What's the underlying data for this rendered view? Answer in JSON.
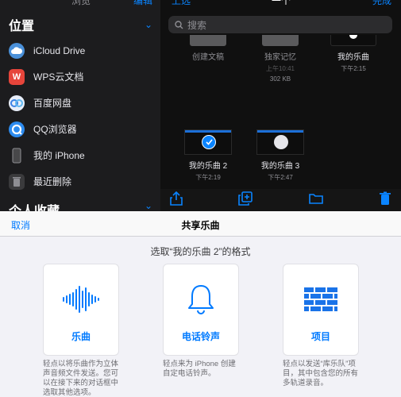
{
  "sidebar": {
    "top_fragment_left": "浏览",
    "top_fragment_right": "编辑",
    "locations_title": "位置",
    "locations": [
      {
        "label": "iCloud Drive",
        "icon": "icloud-icon",
        "color": "#4a90d9"
      },
      {
        "label": "WPS云文档",
        "icon": "wps-icon",
        "color": "#e6453b"
      },
      {
        "label": "百度网盘",
        "icon": "baidu-netdisk-icon",
        "color": "#3b82e6"
      },
      {
        "label": "QQ浏览器",
        "icon": "qq-browser-icon",
        "color": "#2d8cf0"
      },
      {
        "label": "我的 iPhone",
        "icon": "iphone-icon",
        "color": "#3a3a3c"
      },
      {
        "label": "最近删除",
        "icon": "trash-icon",
        "color": "#3a3a3c"
      }
    ],
    "favorites_title": "个人收藏"
  },
  "files": {
    "header_left": "上选",
    "header_title": "一个",
    "header_right": "完成",
    "search_placeholder": "搜索",
    "items": [
      {
        "name": "创建文稿",
        "meta1": "",
        "meta2": ""
      },
      {
        "name": "独家记忆",
        "meta1": "上午10:41",
        "meta2": "302 KB"
      },
      {
        "name": "我的乐曲",
        "meta1": "下午2:15",
        "meta2": ""
      },
      {
        "name": "我的乐曲 2",
        "meta1": "下午2:19",
        "meta2": "",
        "selected": true
      },
      {
        "name": "我的乐曲 3",
        "meta1": "下午2:47",
        "meta2": ""
      }
    ]
  },
  "sheet": {
    "cancel": "取消",
    "title": "共享乐曲",
    "subtitle": "选取“我的乐曲 2”的格式",
    "options": [
      {
        "label": "乐曲",
        "icon": "waveform-icon",
        "desc": "轻点以将乐曲作为立体声音频文件发送。您可以在接下来的对话框中选取其他选项。"
      },
      {
        "label": "电话铃声",
        "icon": "bell-icon",
        "desc": "轻点来为 iPhone 创建自定电话铃声。"
      },
      {
        "label": "项目",
        "icon": "brick-wall-icon",
        "desc": "轻点以发送“库乐队”项目，其中包含您的所有多轨道录音。"
      }
    ]
  },
  "colors": {
    "accent": "#007aff",
    "dark_accent": "#0a84ff"
  }
}
